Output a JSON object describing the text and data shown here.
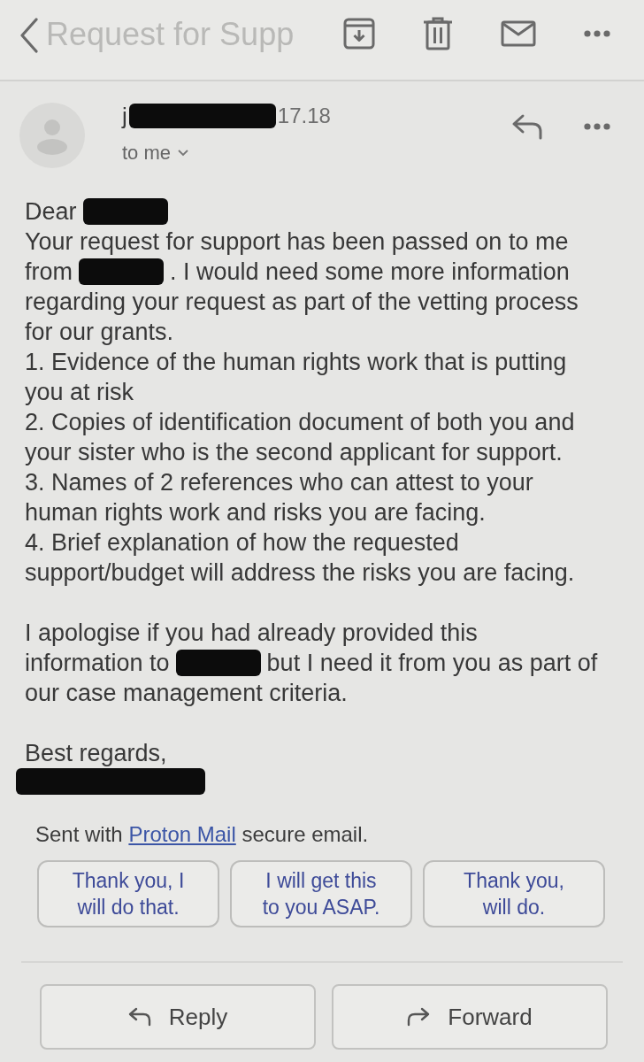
{
  "toolbar": {
    "subject": "Request for Supp"
  },
  "message": {
    "sender": {
      "name": "j",
      "redacted": true,
      "time": "17.18"
    },
    "recipient": "to me"
  },
  "paragraphs": [
    {
      "blocks": [
        {
          "kind": "line",
          "parts": [
            {
              "kind": "text",
              "text": "Dear"
            },
            {
              "kind": "redaction"
            }
          ]
        },
        {
          "kind": "text",
          "text": "Your request for support has been passed on to me"
        },
        {
          "kind": "line",
          "parts": [
            {
              "kind": "text",
              "text": "from"
            },
            {
              "kind": "redaction"
            },
            {
              "kind": "text",
              "text": ". I would need some more information"
            }
          ]
        },
        {
          "kind": "text",
          "text": "regarding your request as part of the vetting process for our grants."
        },
        {
          "kind": "text",
          "text": "1. Evidence of the human rights work that is putting you at risk"
        },
        {
          "kind": "text",
          "text": "2. Copies of identification document of both you and your sister who is the second applicant for support."
        },
        {
          "kind": "text",
          "text": "3. Names of 2 references who can attest to your human rights work and risks you are facing."
        },
        {
          "kind": "text",
          "text": "4. Brief explanation of how the requested support/budget will address the risks you are facing."
        }
      ]
    },
    {
      "blocks": [
        {
          "kind": "text",
          "text": "I apologise if you had already provided this"
        },
        {
          "kind": "line",
          "parts": [
            {
              "kind": "text",
              "text": "information to"
            },
            {
              "kind": "redaction"
            },
            {
              "kind": "text",
              "text": "but I need it from you as part of"
            }
          ]
        },
        {
          "kind": "text",
          "text": "our case management criteria."
        }
      ]
    },
    {
      "blocks": [
        {
          "kind": "text",
          "text": "Best regards,"
        },
        {
          "kind": "redaction"
        }
      ]
    }
  ],
  "footer": {
    "before": "Sent with ",
    "link": "Proton Mail",
    "after": " secure email."
  },
  "smart_replies": [
    "Thank you, I will do that.",
    "I will get this to you ASAP.",
    "Thank you, will do."
  ],
  "actions": [
    {
      "kind": "reply",
      "label": "Reply"
    },
    {
      "kind": "forward",
      "label": "Forward"
    }
  ]
}
